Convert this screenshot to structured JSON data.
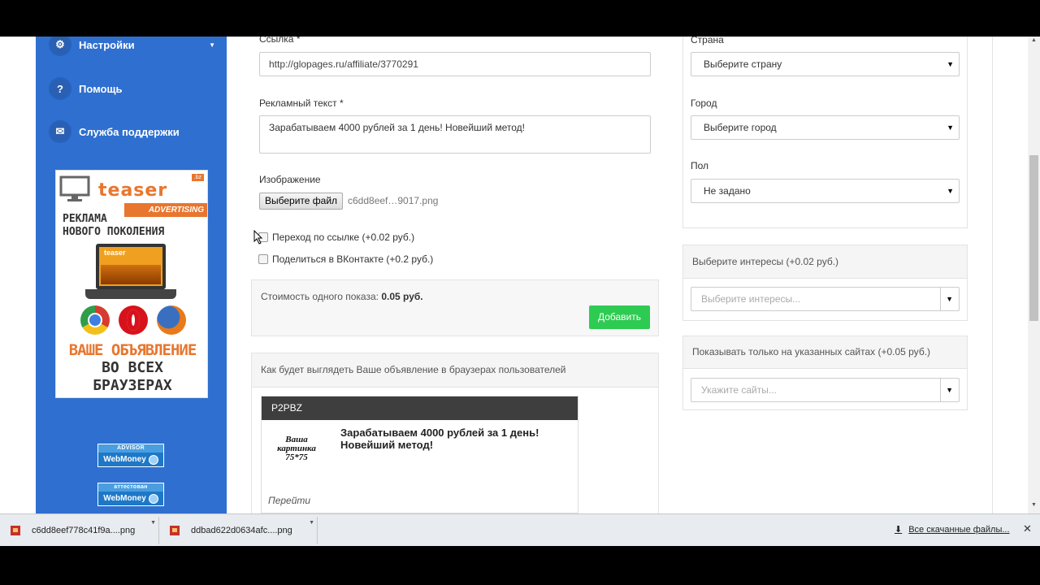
{
  "sidebar": {
    "items": [
      {
        "label": "Настройки",
        "icon": "gear-icon"
      },
      {
        "label": "Помощь",
        "icon": "question-icon"
      },
      {
        "label": "Служба поддержки",
        "icon": "mail-icon"
      }
    ]
  },
  "banner": {
    "brand": "teaser",
    "tld": ".bz",
    "advertising": "ADVERTISING",
    "tagline_1": "РЕКЛАМА",
    "tagline_2": "НОВОГО ПОКОЛЕНИЯ",
    "screen_brand": "teaser",
    "cta_1": "ВАШЕ ОБЪЯВЛЕНИЕ",
    "cta_2": "ВО ВСЕХ",
    "cta_3": "БРАУЗЕРАХ"
  },
  "badges": [
    {
      "top": "ADVISOR",
      "bottom": "WebMoney"
    },
    {
      "top": "аттестован",
      "bottom": "WebMoney"
    }
  ],
  "form": {
    "link_label": "Ссылка *",
    "link_value": "http://glopages.ru/affiliate/3770291",
    "ad_text_label": "Рекламный текст *",
    "ad_text_value": "Зарабатываем 4000 рублей за 1 день! Новейший метод!",
    "image_label": "Изображение",
    "file_button": "Выберите файл",
    "file_name": "c6dd8eef…9017.png",
    "checkbox_1": "Переход по ссылке (+0.02 руб.)",
    "checkbox_2": "Поделиться в ВКонтакте (+0.2 руб.)",
    "cost_label": "Стоимость одного показа:",
    "cost_value": "0.05 руб.",
    "add_button": "Добавить"
  },
  "preview": {
    "heading": "Как будет выглядеть Ваше объявление в браузерах пользователей",
    "site": "P2PBZ",
    "pic_line_1": "Ваша",
    "pic_line_2": "картинка",
    "pic_line_3": "75*75",
    "text": "Зарабатываем 4000 рублей за 1 день! Новейший метод!",
    "go": "Перейти"
  },
  "targeting": {
    "country_label": "Страна",
    "country_value": "Выберите страну",
    "city_label": "Город",
    "city_value": "Выберите город",
    "gender_label": "Пол",
    "gender_value": "Не задано",
    "interests_head": "Выберите интересы (+0.02 руб.)",
    "interests_placeholder": "Выберите интересы...",
    "sites_head": "Показывать только на указанных сайтах (+0.05 руб.)",
    "sites_placeholder": "Укажите сайты..."
  },
  "downloads": {
    "files": [
      "c6dd8eef778c41f9a....png",
      "ddbad622d0634afc....png"
    ],
    "all_label": "Все скачанные файлы..."
  },
  "colors": {
    "sidebar": "#2f6fcf",
    "accent_orange": "#e8762e",
    "add_button": "#2ecb52"
  }
}
